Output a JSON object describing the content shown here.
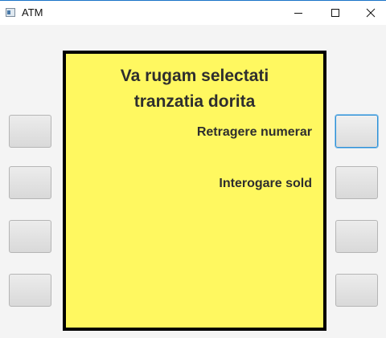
{
  "window": {
    "title": "ATM"
  },
  "screen": {
    "title_line1": "Va rugam selectati",
    "title_line2": "tranzatia dorita",
    "options": [
      "Retragere numerar",
      "Interogare sold"
    ],
    "background_color": "#fff860"
  },
  "accent_color": "#2c8fd6"
}
